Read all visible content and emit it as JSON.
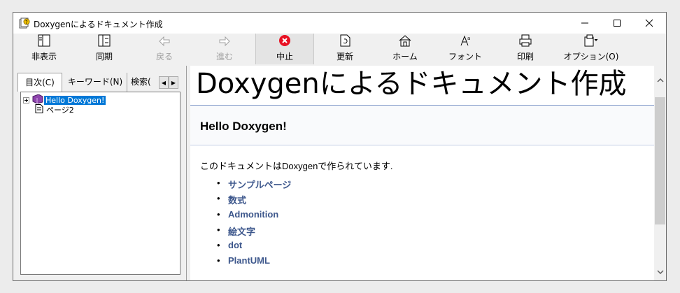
{
  "window": {
    "title": "Doxygenによるドキュメント作成"
  },
  "toolbar": {
    "buttons": [
      {
        "label": "非表示",
        "icon": "hide-icon"
      },
      {
        "label": "同期",
        "icon": "sync-icon"
      },
      {
        "label": "戻る",
        "icon": "back-arrow-icon"
      },
      {
        "label": "進む",
        "icon": "forward-arrow-icon"
      },
      {
        "label": "中止",
        "icon": "stop-icon"
      },
      {
        "label": "更新",
        "icon": "refresh-icon"
      },
      {
        "label": "ホーム",
        "icon": "home-icon"
      },
      {
        "label": "フォント",
        "icon": "font-icon"
      },
      {
        "label": "印刷",
        "icon": "print-icon"
      },
      {
        "label": "オプション(O)",
        "icon": "options-icon"
      }
    ]
  },
  "navpane": {
    "tabs": [
      "目次(C)",
      "キーワード(N)",
      "検索("
    ],
    "tree": [
      {
        "label": "Hello Doxygen!",
        "icon": "book-icon",
        "selected": true
      },
      {
        "label": "ページ2",
        "icon": "page-icon",
        "selected": false
      }
    ]
  },
  "content": {
    "doc_title": "Doxygenによるドキュメント作成",
    "header": "Hello Doxygen!",
    "paragraph": "このドキュメントはDoxygenで作られています.",
    "links": [
      "サンプルページ",
      "数式",
      "Admonition",
      "絵文字",
      "dot",
      "PlantUML"
    ]
  },
  "colors": {
    "link": "#3d578c",
    "selection": "#0078d7",
    "stop": "#e81123"
  }
}
